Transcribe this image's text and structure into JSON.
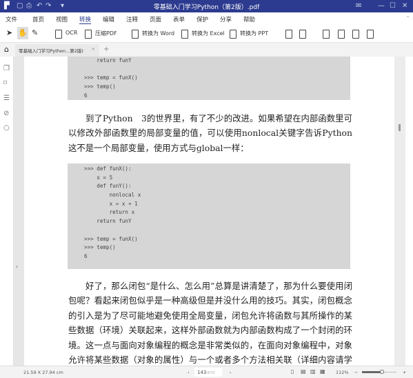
{
  "window": {
    "title": "零基础入门学习Python（第2版）.pdf"
  },
  "menu": [
    "文件",
    "首页",
    "视图",
    "转换",
    "编辑",
    "注释",
    "页面",
    "表单",
    "保护",
    "分享",
    "帮助"
  ],
  "menu_active": "转换",
  "toolbar": {
    "ocr": "OCR",
    "compress": "压缩PDF",
    "to_word": "转换为 Word",
    "to_excel": "转换为 Excel",
    "to_ppt": "转换为 PPT"
  },
  "tab": {
    "label": "零基础入门学习Python...第2版)",
    "close": "×",
    "add": "+"
  },
  "code1": [
    "    return funY",
    "",
    ">>> temp = funX()",
    ">>> temp()",
    "6"
  ],
  "para1": "到了Python　3的世界里，有了不少的改进。如果希望在内部函数里可以修改外部函数里的局部变量的值，可以使用nonlocal关键字告诉Python这不是一个局部变量，使用方式与global一样：",
  "code2": [
    ">>> def funX():",
    "    x = 5",
    "    def funY():",
    "        nonlocal x",
    "        x = x + 1",
    "        return x",
    "    return funY",
    "",
    ">>> temp = funX()",
    ">>> temp()",
    "6"
  ],
  "para2": "好了，那么闭包“是什么、怎么用”总算是讲清楚了，那为什么要使用闭包呢？看起来闭包似乎是一种高级但是并没什么用的技巧。其实，闭包概念的引入是为了尽可能地避免使用全局变量，闭包允许将函数与其所操作的某些数据（环境）关联起来，这样外部函数就为内部函数构成了一个封闭的环境。这一点与面向对象编程的概念是非常类似的，在面向对象编程中，对象允许将某些数据（对象的属性）与一个或者多个方法相关联（详细内容请学习第11章，类和对象）",
  "status": {
    "page_size": "21.59 X 27.94 cm",
    "current_page": "143",
    "total_pages": "/670",
    "zoom": "112%",
    "zoom_level_percent": 112
  },
  "colors": {
    "titlebar": "#2c3b8f",
    "code_bg": "#d6d6d6"
  }
}
